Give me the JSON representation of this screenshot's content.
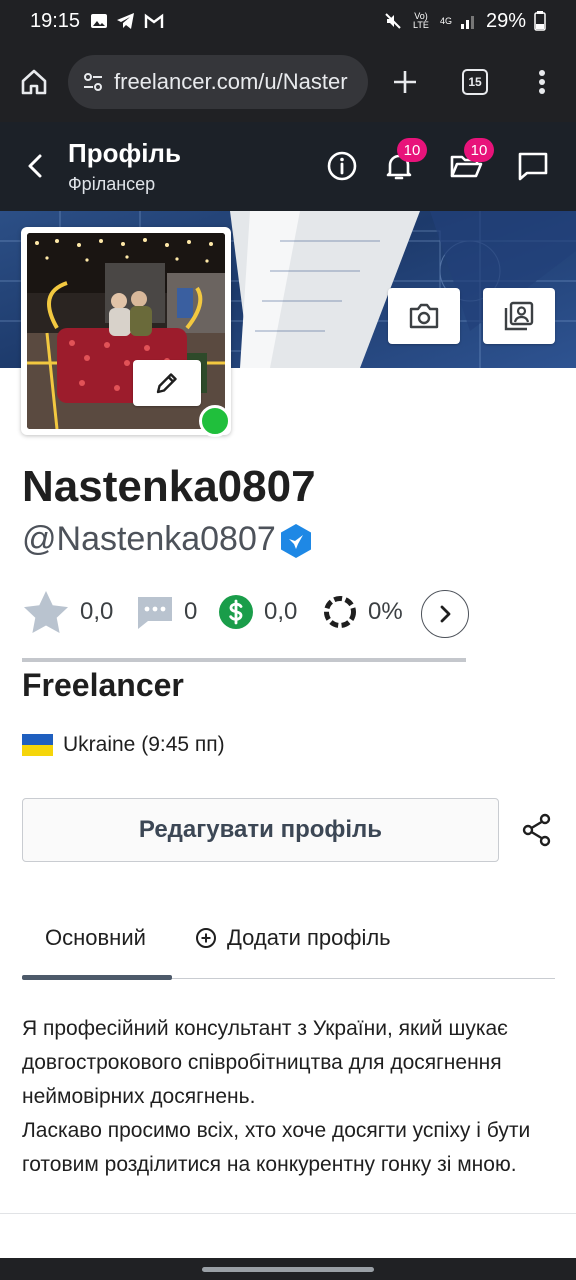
{
  "status_bar": {
    "time": "19:15",
    "signal_top": "Vo) LTE",
    "network": "4G",
    "battery": "29%"
  },
  "browser": {
    "url": "freelancer.com/u/Naster",
    "tab_count": "15"
  },
  "header": {
    "title": "Профіль",
    "subtitle": "Фрілансер",
    "notifications_badge": "10",
    "projects_badge": "10"
  },
  "profile": {
    "username": "Nastenka0807",
    "handle": "@Nastenka0807",
    "stats": {
      "rating": "0,0",
      "reviews": "0",
      "earnings": "0,0",
      "completion": "0%"
    },
    "section_title": "Freelancer",
    "location": "Ukraine (9:45 пп)",
    "edit_button": "Редагувати профіль"
  },
  "tabs": [
    {
      "label": "Основний"
    },
    {
      "label": "Додати профіль"
    }
  ],
  "about": {
    "line1": "Я професійний консультант з України, який шукає довгострокового співробітництва для досягнення неймовірних досягнень.",
    "line2": "Ласкаво просимо всіх, хто хоче досягти успіху і бути готовим розділитися на конкурентну гонку зі мною."
  },
  "colors": {
    "header_bg": "#1c2128",
    "badge": "#e8137a",
    "online": "#20bf3c",
    "verified": "#1e88e5",
    "earnings": "#1a9d4a"
  }
}
